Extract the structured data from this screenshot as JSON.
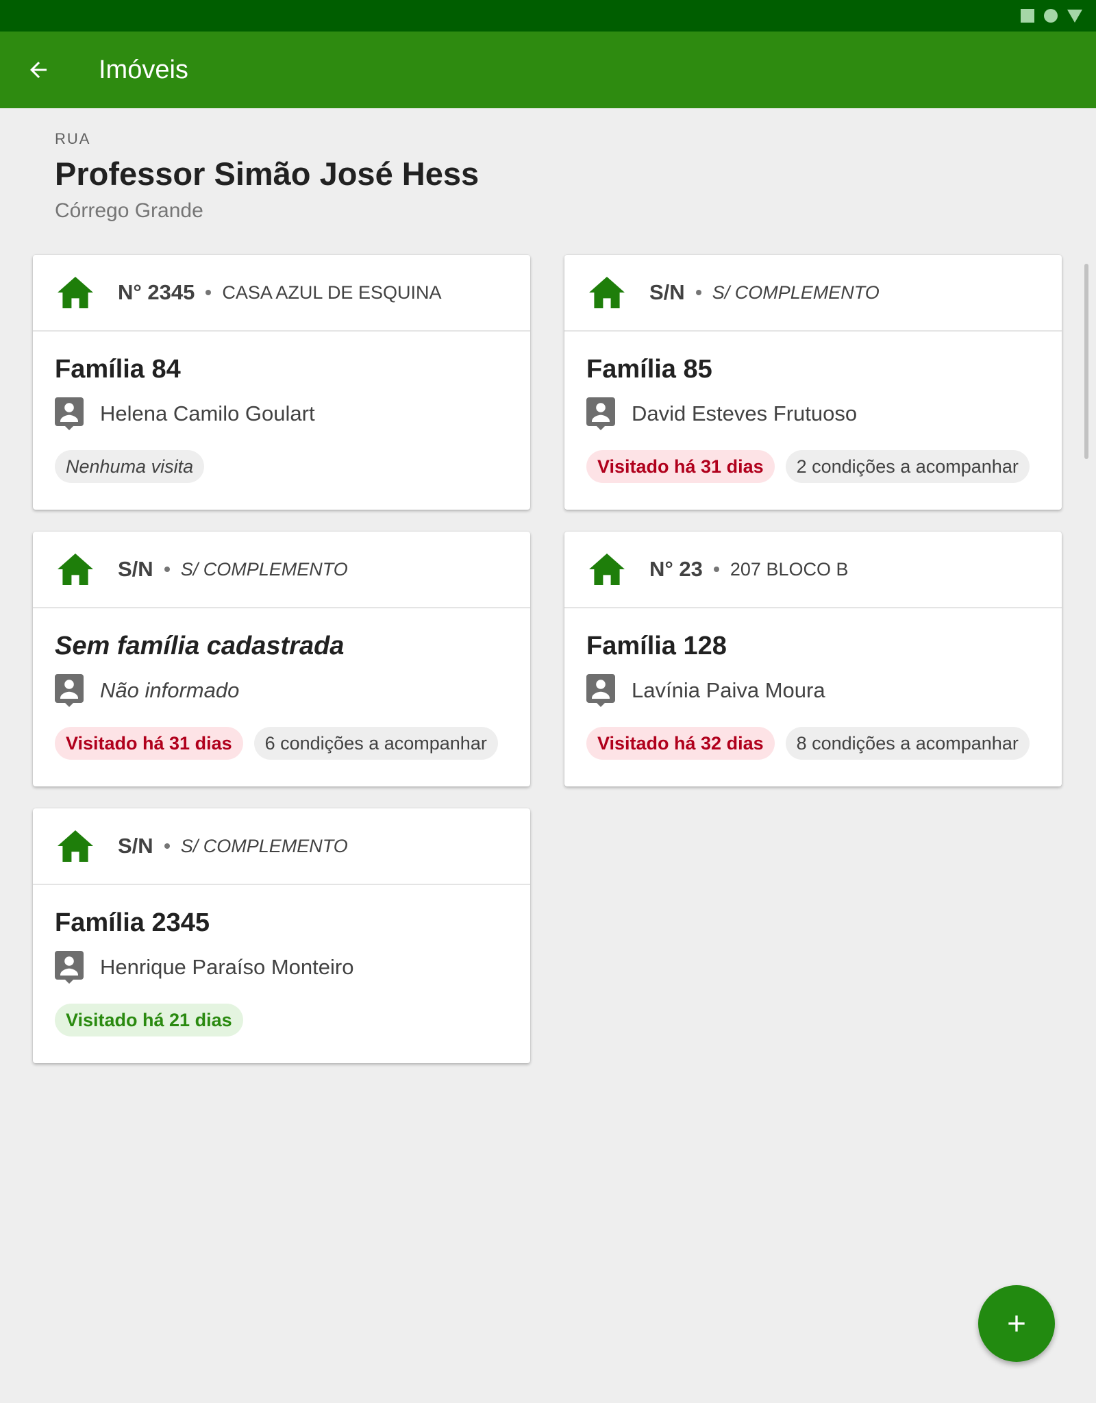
{
  "app_bar": {
    "title": "Imóveis",
    "back_icon": "arrow-back-icon",
    "color": "#2e8b10"
  },
  "status_bar": {
    "icons": [
      "square-icon",
      "circle-icon",
      "triangle-icon"
    ],
    "color": "#005e00"
  },
  "header": {
    "type": "RUA",
    "name": "Professor Simão José Hess",
    "district": "Córrego Grande"
  },
  "cards": [
    {
      "number": "N° 2345",
      "complement": "CASA AZUL DE ESQUINA",
      "family": "Família 84",
      "responsible": "Helena Camilo Goulart",
      "visit_chip": "Nenhuma visita",
      "conditions_chip": ""
    },
    {
      "number": "S/N",
      "complement": "S/ COMPLEMENTO",
      "family": "Família 85",
      "responsible": "David Esteves Frutuoso",
      "visit_chip": "Visitado há 31 dias",
      "conditions_chip": "2 condições a acompanhar"
    },
    {
      "number": "S/N",
      "complement": "S/ COMPLEMENTO",
      "family": "Sem família cadastrada",
      "responsible": "Não informado",
      "visit_chip": "Visitado há 31 dias",
      "conditions_chip": "6 condições a acompanhar"
    },
    {
      "number": "N° 23",
      "complement": "207 BLOCO B",
      "family": "Família 128",
      "responsible": "Lavínia Paiva Moura",
      "visit_chip": "Visitado há 32 dias",
      "conditions_chip": "8 condições a acompanhar"
    },
    {
      "number": "S/N",
      "complement": "S/ COMPLEMENTO",
      "family": "Família 2345",
      "responsible": "Henrique Paraíso Monteiro",
      "visit_chip": "Visitado há 21 dias",
      "conditions_chip": ""
    }
  ],
  "fab": {
    "icon": "plus-icon",
    "color": "#228a10"
  },
  "colors": {
    "home_icon": "#1e7e0a",
    "chip_red_text": "#b0001c",
    "chip_green_text": "#2a8a10",
    "background": "#eeeeee"
  }
}
